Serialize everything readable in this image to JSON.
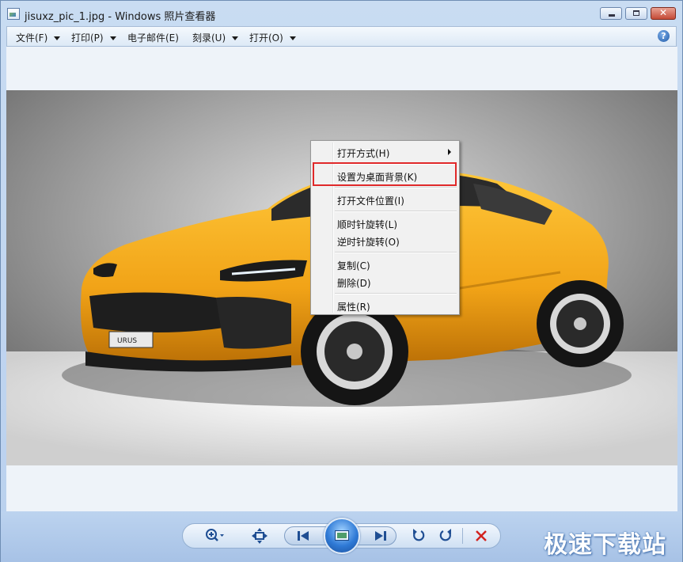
{
  "window": {
    "title": "jisuxz_pic_1.jpg - Windows 照片查看器"
  },
  "menubar": {
    "items": [
      {
        "label": "文件(F)",
        "has_dropdown": true
      },
      {
        "label": "打印(P)",
        "has_dropdown": true
      },
      {
        "label": "电子邮件(E)",
        "has_dropdown": false
      },
      {
        "label": "刻录(U)",
        "has_dropdown": true
      },
      {
        "label": "打开(O)",
        "has_dropdown": true
      }
    ],
    "help": "?"
  },
  "context_menu": {
    "items": [
      {
        "label": "打开方式(H)",
        "submenu": true
      },
      {
        "label": "设置为桌面背景(K)",
        "highlighted": true
      },
      {
        "label": "打开文件位置(I)"
      },
      {
        "label": "顺时针旋转(L)"
      },
      {
        "label": "逆时针旋转(O)"
      },
      {
        "label": "复制(C)"
      },
      {
        "label": "删除(D)"
      },
      {
        "label": "属性(R)"
      }
    ],
    "highlight_color": "#e0292a"
  },
  "toolbar": {
    "zoom_icon": "zoom-icon",
    "fit_icon": "actual-size-icon",
    "prev_icon": "previous-icon",
    "slideshow_icon": "slideshow-icon",
    "next_icon": "next-icon",
    "rotate_ccw_icon": "rotate-counterclockwise-icon",
    "rotate_cw_icon": "rotate-clockwise-icon",
    "delete_icon": "delete-icon"
  },
  "watermark": {
    "text": "极速下载站"
  },
  "photo": {
    "badge": "URUS",
    "body_color": "#f4a81c"
  }
}
